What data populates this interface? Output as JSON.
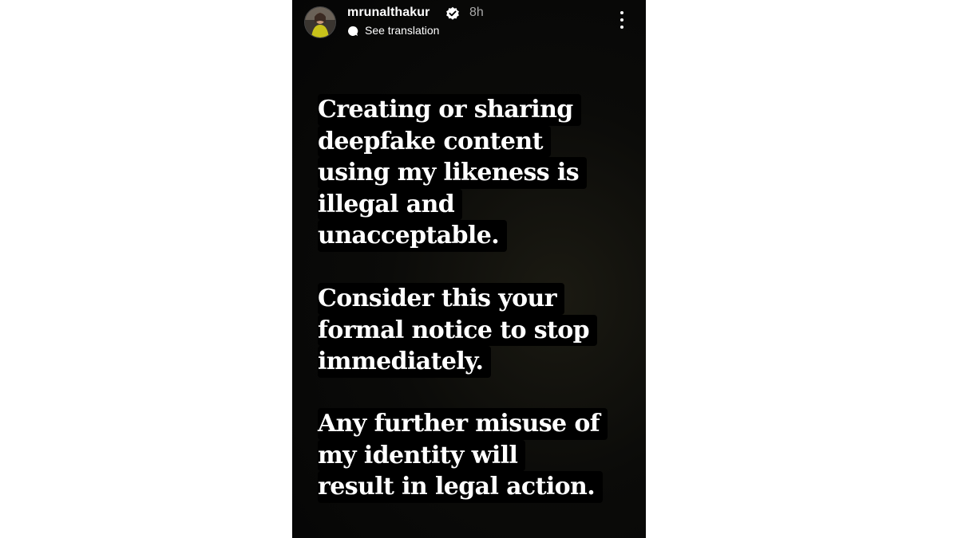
{
  "header": {
    "username": "mrunalthakur",
    "time": "8h",
    "translation_label": "See translation"
  },
  "icons": {
    "verified": "verified-badge-icon",
    "translation": "speech-bubble-icon",
    "more": "more-options-icon",
    "verified_color": "#3897f0"
  },
  "story": {
    "paragraphs": [
      {
        "lines": [
          "Creating or sharing",
          "deepfake content",
          "using my likeness is",
          "illegal and",
          "unacceptable."
        ]
      },
      {
        "lines": [
          "Consider this your",
          "formal notice to stop",
          "immediately."
        ]
      },
      {
        "lines": [
          "Any further misuse of",
          "my identity will",
          "result in legal action."
        ]
      }
    ]
  }
}
